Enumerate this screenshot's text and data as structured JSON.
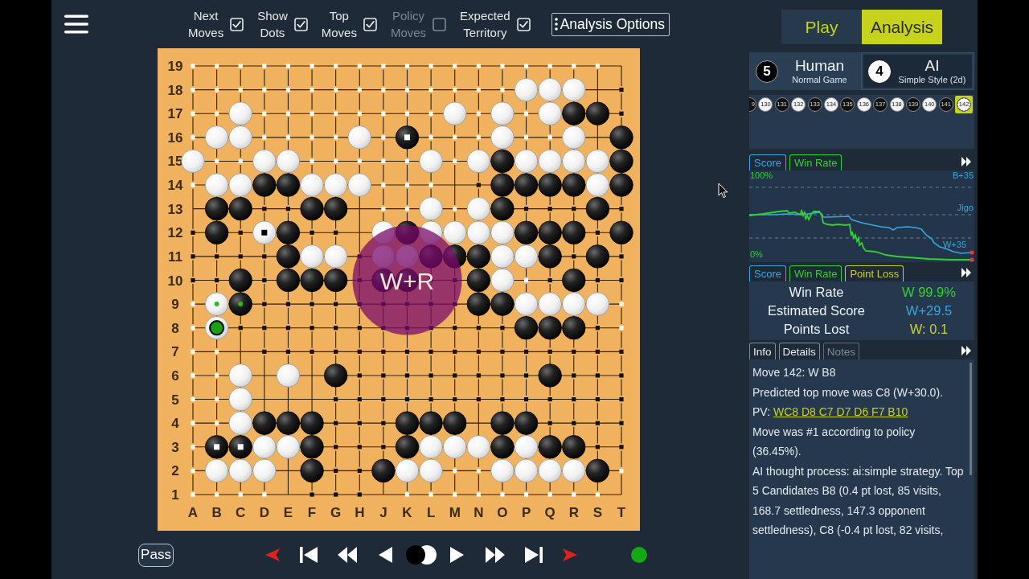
{
  "toolbar": {
    "toggles": [
      {
        "label": "Next Moves",
        "checked": true
      },
      {
        "label": "Show Dots",
        "checked": true
      },
      {
        "label": "Top Moves",
        "checked": true
      },
      {
        "label": "Policy Moves",
        "checked": false
      },
      {
        "label": "Expected Territory",
        "checked": true
      }
    ],
    "options_button": "Analysis Options"
  },
  "board": {
    "columns": [
      "A",
      "B",
      "C",
      "D",
      "E",
      "F",
      "G",
      "H",
      "J",
      "K",
      "L",
      "M",
      "N",
      "O",
      "P",
      "Q",
      "R",
      "S",
      "T"
    ],
    "rows": [
      {
        "label": "19",
        "points": [
          {
            "kind": "white_area"
          },
          {
            "kind": "white_area"
          },
          {
            "kind": "white_area"
          },
          {
            "kind": "white_area"
          },
          {
            "kind": "white_area"
          },
          {
            "kind": "white_area"
          },
          {
            "kind": "white_area"
          },
          {
            "kind": "white_area"
          },
          {
            "kind": "white_area"
          },
          {
            "kind": "white_area"
          },
          {
            "kind": "white_area"
          },
          {
            "kind": "white_area"
          },
          {
            "kind": "white_area"
          },
          {
            "kind": "white_area"
          },
          {
            "kind": "white_area"
          },
          {
            "kind": "white_area"
          },
          {
            "kind": "white_area"
          },
          {
            "kind": "white_area"
          },
          {
            "kind": "empty"
          }
        ]
      },
      {
        "label": "18",
        "points": [
          {
            "kind": "white_area"
          },
          {
            "kind": "white_area"
          },
          {
            "kind": "white_area"
          },
          {
            "kind": "white_area"
          },
          {
            "kind": "white_area"
          },
          {
            "kind": "white_area"
          },
          {
            "kind": "white_area"
          },
          {
            "kind": "white_area"
          },
          {
            "kind": "white_area"
          },
          {
            "kind": "white_area"
          },
          {
            "kind": "white_area"
          },
          {
            "kind": "white_area"
          },
          {
            "kind": "white_area"
          },
          {
            "kind": "white_area"
          },
          {
            "kind": "white"
          },
          {
            "kind": "white"
          },
          {
            "kind": "white"
          },
          {
            "kind": "empty"
          },
          {
            "kind": "black_area"
          }
        ]
      },
      {
        "label": "17",
        "points": [
          {
            "kind": "white_area"
          },
          {
            "kind": "white_area"
          },
          {
            "kind": "white"
          },
          {
            "kind": "white_area"
          },
          {
            "kind": "white_area"
          },
          {
            "kind": "white_area"
          },
          {
            "kind": "white_area"
          },
          {
            "kind": "white_area"
          },
          {
            "kind": "white_area"
          },
          {
            "kind": "white_area"
          },
          {
            "kind": "white_area"
          },
          {
            "kind": "white"
          },
          {
            "kind": "white_area"
          },
          {
            "kind": "white"
          },
          {
            "kind": "white_area"
          },
          {
            "kind": "white"
          },
          {
            "kind": "black"
          },
          {
            "kind": "black"
          },
          {
            "kind": "black_area"
          }
        ]
      },
      {
        "label": "16",
        "points": [
          {
            "kind": "white_area"
          },
          {
            "kind": "white"
          },
          {
            "kind": "white"
          },
          {
            "kind": "white_area"
          },
          {
            "kind": "white_area"
          },
          {
            "kind": "white_area"
          },
          {
            "kind": "white_area"
          },
          {
            "kind": "white"
          },
          {
            "kind": "white_area"
          },
          {
            "kind": "black_dead"
          },
          {
            "kind": "white_area"
          },
          {
            "kind": "white_area"
          },
          {
            "kind": "white_area"
          },
          {
            "kind": "white"
          },
          {
            "kind": "white_area"
          },
          {
            "kind": "white_area"
          },
          {
            "kind": "white"
          },
          {
            "kind": "empty"
          },
          {
            "kind": "black"
          }
        ]
      },
      {
        "label": "15",
        "points": [
          {
            "kind": "white"
          },
          {
            "kind": "white_area"
          },
          {
            "kind": "white_area"
          },
          {
            "kind": "white"
          },
          {
            "kind": "white"
          },
          {
            "kind": "white_area"
          },
          {
            "kind": "white_area"
          },
          {
            "kind": "white_area"
          },
          {
            "kind": "white_area"
          },
          {
            "kind": "white_area"
          },
          {
            "kind": "white"
          },
          {
            "kind": "white_area"
          },
          {
            "kind": "white"
          },
          {
            "kind": "black"
          },
          {
            "kind": "white"
          },
          {
            "kind": "white"
          },
          {
            "kind": "white"
          },
          {
            "kind": "white"
          },
          {
            "kind": "black"
          }
        ]
      },
      {
        "label": "14",
        "points": [
          {
            "kind": "white_area"
          },
          {
            "kind": "white"
          },
          {
            "kind": "white"
          },
          {
            "kind": "black"
          },
          {
            "kind": "black"
          },
          {
            "kind": "white"
          },
          {
            "kind": "white"
          },
          {
            "kind": "white"
          },
          {
            "kind": "white_area"
          },
          {
            "kind": "white_area"
          },
          {
            "kind": "white_area"
          },
          {
            "kind": "empty"
          },
          {
            "kind": "black_area"
          },
          {
            "kind": "black"
          },
          {
            "kind": "black"
          },
          {
            "kind": "black"
          },
          {
            "kind": "black"
          },
          {
            "kind": "white"
          },
          {
            "kind": "black"
          }
        ]
      },
      {
        "label": "13",
        "points": [
          {
            "kind": "empty"
          },
          {
            "kind": "black"
          },
          {
            "kind": "black"
          },
          {
            "kind": "black_area"
          },
          {
            "kind": "black_area"
          },
          {
            "kind": "black"
          },
          {
            "kind": "black"
          },
          {
            "kind": "empty"
          },
          {
            "kind": "white_area"
          },
          {
            "kind": "white_area"
          },
          {
            "kind": "white"
          },
          {
            "kind": "white_area"
          },
          {
            "kind": "white"
          },
          {
            "kind": "black"
          },
          {
            "kind": "black_area"
          },
          {
            "kind": "black_area"
          },
          {
            "kind": "black_area"
          },
          {
            "kind": "black"
          },
          {
            "kind": "black_area"
          }
        ]
      },
      {
        "label": "12",
        "points": [
          {
            "kind": "black_area"
          },
          {
            "kind": "black"
          },
          {
            "kind": "black_area"
          },
          {
            "kind": "white_dead"
          },
          {
            "kind": "black"
          },
          {
            "kind": "black_area"
          },
          {
            "kind": "black_area"
          },
          {
            "kind": "empty"
          },
          {
            "kind": "white"
          },
          {
            "kind": "black"
          },
          {
            "kind": "white"
          },
          {
            "kind": "white"
          },
          {
            "kind": "white"
          },
          {
            "kind": "white"
          },
          {
            "kind": "black"
          },
          {
            "kind": "black"
          },
          {
            "kind": "black"
          },
          {
            "kind": "black_area"
          },
          {
            "kind": "black"
          }
        ]
      },
      {
        "label": "11",
        "points": [
          {
            "kind": "black_area"
          },
          {
            "kind": "black_area"
          },
          {
            "kind": "black_area"
          },
          {
            "kind": "black_area"
          },
          {
            "kind": "black"
          },
          {
            "kind": "white"
          },
          {
            "kind": "white"
          },
          {
            "kind": "black_area"
          },
          {
            "kind": "white"
          },
          {
            "kind": "white"
          },
          {
            "kind": "black"
          },
          {
            "kind": "black"
          },
          {
            "kind": "black"
          },
          {
            "kind": "white"
          },
          {
            "kind": "white"
          },
          {
            "kind": "black"
          },
          {
            "kind": "black_area"
          },
          {
            "kind": "black"
          },
          {
            "kind": "black_area"
          }
        ]
      },
      {
        "label": "10",
        "points": [
          {
            "kind": "black_area"
          },
          {
            "kind": "black_area"
          },
          {
            "kind": "black"
          },
          {
            "kind": "black_area"
          },
          {
            "kind": "black"
          },
          {
            "kind": "black"
          },
          {
            "kind": "black"
          },
          {
            "kind": "black_area"
          },
          {
            "kind": "black"
          },
          {
            "kind": "black",
            "hint": "W+R"
          },
          {
            "kind": "black_area"
          },
          {
            "kind": "black_area"
          },
          {
            "kind": "black"
          },
          {
            "kind": "white"
          },
          {
            "kind": "white_area"
          },
          {
            "kind": "black_area"
          },
          {
            "kind": "black"
          },
          {
            "kind": "black_area"
          },
          {
            "kind": "black_area"
          }
        ]
      },
      {
        "label": "9",
        "points": [
          {
            "kind": "white_area"
          },
          {
            "kind": "white",
            "color": "#20c020"
          },
          {
            "kind": "black",
            "color": "#20c020"
          },
          {
            "kind": "black_area"
          },
          {
            "kind": "black_area"
          },
          {
            "kind": "black_area"
          },
          {
            "kind": "black_area"
          },
          {
            "kind": "black_area"
          },
          {
            "kind": "black_area"
          },
          {
            "kind": "black_area"
          },
          {
            "kind": "black_area"
          },
          {
            "kind": "black_area"
          },
          {
            "kind": "black"
          },
          {
            "kind": "black"
          },
          {
            "kind": "white"
          },
          {
            "kind": "white"
          },
          {
            "kind": "white"
          },
          {
            "kind": "white"
          },
          {
            "kind": "white_area"
          }
        ]
      },
      {
        "label": "8",
        "points": [
          {
            "kind": "white_area"
          },
          {
            "kind": "white_current",
            "color": "#18a018"
          },
          {
            "kind": "black_area"
          },
          {
            "kind": "black_area"
          },
          {
            "kind": "black_area"
          },
          {
            "kind": "black_area"
          },
          {
            "kind": "black_area"
          },
          {
            "kind": "black_area"
          },
          {
            "kind": "black_area"
          },
          {
            "kind": "black_area"
          },
          {
            "kind": "black_area"
          },
          {
            "kind": "black_area"
          },
          {
            "kind": "black_area"
          },
          {
            "kind": "black_area"
          },
          {
            "kind": "black"
          },
          {
            "kind": "black"
          },
          {
            "kind": "black"
          },
          {
            "kind": "black_area"
          },
          {
            "kind": "white_area"
          }
        ]
      },
      {
        "label": "7",
        "points": [
          {
            "kind": "white_area"
          },
          {
            "kind": "white_area"
          },
          {
            "kind": "empty"
          },
          {
            "kind": "black_area"
          },
          {
            "kind": "black_area"
          },
          {
            "kind": "black_area"
          },
          {
            "kind": "black_area"
          },
          {
            "kind": "black_area"
          },
          {
            "kind": "black_area"
          },
          {
            "kind": "black_area"
          },
          {
            "kind": "black_area"
          },
          {
            "kind": "black_area"
          },
          {
            "kind": "black_area"
          },
          {
            "kind": "black_area"
          },
          {
            "kind": "black_area"
          },
          {
            "kind": "black_area"
          },
          {
            "kind": "black_area"
          },
          {
            "kind": "black_area"
          },
          {
            "kind": "black_area"
          }
        ]
      },
      {
        "label": "6",
        "points": [
          {
            "kind": "white_area"
          },
          {
            "kind": "white_area"
          },
          {
            "kind": "white"
          },
          {
            "kind": "empty"
          },
          {
            "kind": "white"
          },
          {
            "kind": "empty"
          },
          {
            "kind": "black"
          },
          {
            "kind": "black_area"
          },
          {
            "kind": "black_area"
          },
          {
            "kind": "black_area"
          },
          {
            "kind": "black_area"
          },
          {
            "kind": "black_area"
          },
          {
            "kind": "black_area"
          },
          {
            "kind": "black_area"
          },
          {
            "kind": "black_area"
          },
          {
            "kind": "black"
          },
          {
            "kind": "black_area"
          },
          {
            "kind": "black_area"
          },
          {
            "kind": "black_area"
          }
        ]
      },
      {
        "label": "5",
        "points": [
          {
            "kind": "white_area"
          },
          {
            "kind": "white_area"
          },
          {
            "kind": "white"
          },
          {
            "kind": "empty"
          },
          {
            "kind": "empty"
          },
          {
            "kind": "empty"
          },
          {
            "kind": "black_area"
          },
          {
            "kind": "black_area"
          },
          {
            "kind": "black_area"
          },
          {
            "kind": "black_area"
          },
          {
            "kind": "black_area"
          },
          {
            "kind": "black_area"
          },
          {
            "kind": "black_area"
          },
          {
            "kind": "black_area"
          },
          {
            "kind": "black_area"
          },
          {
            "kind": "black_area"
          },
          {
            "kind": "black_area"
          },
          {
            "kind": "black_area"
          },
          {
            "kind": "black_area"
          }
        ]
      },
      {
        "label": "4",
        "points": [
          {
            "kind": "white_area"
          },
          {
            "kind": "white_area"
          },
          {
            "kind": "white"
          },
          {
            "kind": "black"
          },
          {
            "kind": "black"
          },
          {
            "kind": "black"
          },
          {
            "kind": "black_area"
          },
          {
            "kind": "black_area"
          },
          {
            "kind": "black_area"
          },
          {
            "kind": "black"
          },
          {
            "kind": "black"
          },
          {
            "kind": "black"
          },
          {
            "kind": "empty"
          },
          {
            "kind": "black"
          },
          {
            "kind": "black"
          },
          {
            "kind": "black_area"
          },
          {
            "kind": "black_area"
          },
          {
            "kind": "black_area"
          },
          {
            "kind": "black_area"
          }
        ]
      },
      {
        "label": "3",
        "points": [
          {
            "kind": "white_area"
          },
          {
            "kind": "black_dead"
          },
          {
            "kind": "black_dead"
          },
          {
            "kind": "white"
          },
          {
            "kind": "white"
          },
          {
            "kind": "black"
          },
          {
            "kind": "black_area"
          },
          {
            "kind": "black_area"
          },
          {
            "kind": "black_area"
          },
          {
            "kind": "black"
          },
          {
            "kind": "white"
          },
          {
            "kind": "white"
          },
          {
            "kind": "white"
          },
          {
            "kind": "black"
          },
          {
            "kind": "white"
          },
          {
            "kind": "black"
          },
          {
            "kind": "black"
          },
          {
            "kind": "black_area"
          },
          {
            "kind": "black_area"
          }
        ]
      },
      {
        "label": "2",
        "points": [
          {
            "kind": "white_area"
          },
          {
            "kind": "white"
          },
          {
            "kind": "white"
          },
          {
            "kind": "white"
          },
          {
            "kind": "empty"
          },
          {
            "kind": "black"
          },
          {
            "kind": "black_area"
          },
          {
            "kind": "black_area"
          },
          {
            "kind": "black"
          },
          {
            "kind": "white"
          },
          {
            "kind": "white"
          },
          {
            "kind": "white_area"
          },
          {
            "kind": "white_area"
          },
          {
            "kind": "white"
          },
          {
            "kind": "white"
          },
          {
            "kind": "white"
          },
          {
            "kind": "white"
          },
          {
            "kind": "black"
          },
          {
            "kind": "white_area"
          }
        ]
      },
      {
        "label": "1",
        "points": [
          {
            "kind": "white_area"
          },
          {
            "kind": "white_area"
          },
          {
            "kind": "white_area"
          },
          {
            "kind": "white_area"
          },
          {
            "kind": "empty"
          },
          {
            "kind": "black_area"
          },
          {
            "kind": "black_area"
          },
          {
            "kind": "black_area"
          },
          {
            "kind": "empty"
          },
          {
            "kind": "white_area"
          },
          {
            "kind": "white_area"
          },
          {
            "kind": "white_area"
          },
          {
            "kind": "white_area"
          },
          {
            "kind": "white_area"
          },
          {
            "kind": "white_area"
          },
          {
            "kind": "white_area"
          },
          {
            "kind": "white_area"
          },
          {
            "kind": "white_area"
          },
          {
            "kind": "empty"
          }
        ]
      }
    ]
  },
  "bottom_bar": {
    "pass_button": "Pass",
    "engine": {
      "color": "#14a814"
    }
  },
  "mode_tabs": [
    {
      "label": "Play",
      "selected": false
    },
    {
      "label": "Analysis",
      "selected": true
    }
  ],
  "players": [
    {
      "captures": "5",
      "name": "Human",
      "subtitle": "Normal Game",
      "kind": "black",
      "selected": true
    },
    {
      "captures": "4",
      "name": "AI",
      "subtitle": "Simple Style (2d)",
      "kind": "white",
      "selected": false
    }
  ],
  "move_tree": [
    {
      "label": "9",
      "kind": "black",
      "selected": false
    },
    {
      "label": "130",
      "kind": "white",
      "selected": false
    },
    {
      "label": "131",
      "kind": "black",
      "selected": false
    },
    {
      "label": "132",
      "kind": "white",
      "selected": false
    },
    {
      "label": "133",
      "kind": "black",
      "selected": false
    },
    {
      "label": "134",
      "kind": "white",
      "selected": false
    },
    {
      "label": "135",
      "kind": "black",
      "selected": false
    },
    {
      "label": "136",
      "kind": "white",
      "selected": false
    },
    {
      "label": "137",
      "kind": "black",
      "selected": false
    },
    {
      "label": "138",
      "kind": "white",
      "selected": false
    },
    {
      "label": "139",
      "kind": "black",
      "selected": false
    },
    {
      "label": "140",
      "kind": "white",
      "selected": false
    },
    {
      "label": "141",
      "kind": "black",
      "selected": false
    },
    {
      "label": "142",
      "kind": "white",
      "selected": true
    }
  ],
  "graph_tabs": [
    {
      "label": "Score",
      "kind": "score"
    },
    {
      "label": "Win Rate",
      "kind": "winrate"
    }
  ],
  "graph": {
    "win_rate_max": "100%",
    "win_rate_min": "0%",
    "score_max": "B+35",
    "score_even": "Jigo",
    "score_min": "W+35"
  },
  "stat_tabs": [
    {
      "label": "Score",
      "kind": "score"
    },
    {
      "label": "Win Rate",
      "kind": "winrate"
    },
    {
      "label": "Point Loss",
      "kind": "loss"
    }
  ],
  "stats": [
    {
      "label": "Win Rate",
      "value": "W 99.9%",
      "kind": "winrate"
    },
    {
      "label": "Estimated Score",
      "value": "W+29.5",
      "kind": "score"
    },
    {
      "label": "Points Lost",
      "value": "W: 0.1",
      "kind": "loss"
    }
  ],
  "info_tabs": [
    {
      "label": "Info",
      "on": true
    },
    {
      "label": "Details",
      "on": true
    },
    {
      "label": "Notes",
      "on": false
    }
  ],
  "info": {
    "lines": [
      {
        "text": "Move 142: W B8"
      },
      {
        "text": "Predicted top move was C8 (W+30.0)."
      },
      {
        "text": "PV:",
        "link": "WC8 D8 C7 D7 D6 F7 B10"
      },
      {
        "text": "Move was #1 according to policy (36.45%)."
      }
    ],
    "ai_notes": "AI thought process: ai:simple strategy. Top 5 Candidates B8 (0.4 pt lost, 85 visits, 168.7 settledness, 147.3 opponent settledness), C8 (-0.4 pt lost, 82 visits,"
  }
}
